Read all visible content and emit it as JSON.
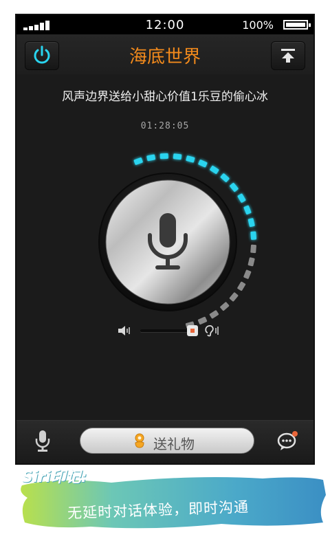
{
  "status_bar": {
    "time": "12:00",
    "battery": "100%"
  },
  "header": {
    "title": "海底世界"
  },
  "message": "风声边界送给小甜心价值1乐豆的偷心冰",
  "timer": "01:28:05",
  "recording_level": 0.6,
  "volume_level": 0.9,
  "bottom_bar": {
    "gift_label": "送礼物"
  },
  "banner": {
    "tag": "Siri印记:",
    "slogan": "无延时对话体验，即时沟通"
  },
  "colors": {
    "accent_orange": "#f28a1c",
    "meter_cyan": "#29d4ef",
    "meter_gray": "#8a8a8a",
    "slider_dot": "#e9663a"
  }
}
